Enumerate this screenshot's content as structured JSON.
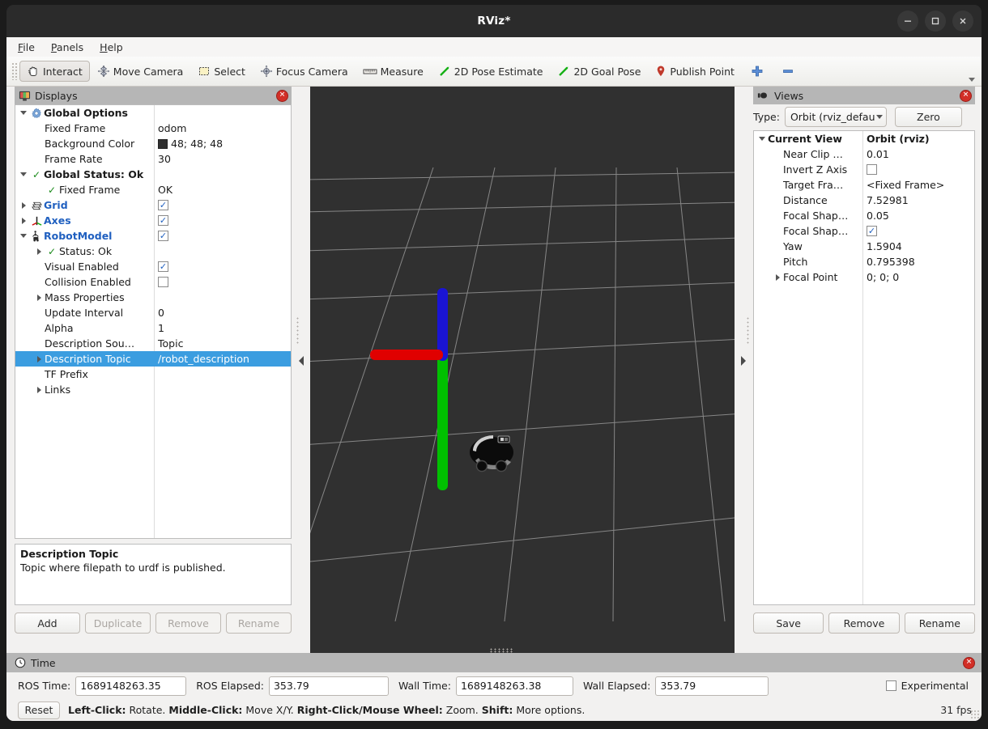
{
  "window": {
    "title": "RViz*",
    "controls": [
      {
        "name": "minimize",
        "glyph": "minimize-icon"
      },
      {
        "name": "maximize",
        "glyph": "maximize-icon"
      },
      {
        "name": "close",
        "glyph": "close-icon"
      }
    ]
  },
  "menu": {
    "items": [
      {
        "label": "File",
        "mnemonic": "F"
      },
      {
        "label": "Panels",
        "mnemonic": "P"
      },
      {
        "label": "Help",
        "mnemonic": "H"
      }
    ]
  },
  "toolbar": {
    "buttons": [
      {
        "label": "Interact",
        "icon": "hand-cursor-icon",
        "checked": true
      },
      {
        "label": "Move Camera",
        "icon": "move-camera-icon",
        "checked": false
      },
      {
        "label": "Select",
        "icon": "selection-rect-icon",
        "checked": false
      },
      {
        "label": "Focus Camera",
        "icon": "focus-camera-icon",
        "checked": false
      },
      {
        "label": "Measure",
        "icon": "ruler-icon",
        "checked": false
      },
      {
        "label": "2D Pose Estimate",
        "icon": "green-arrow-icon",
        "checked": false
      },
      {
        "label": "2D Goal Pose",
        "icon": "green-arrow-icon",
        "checked": false
      },
      {
        "label": "Publish Point",
        "icon": "map-pin-icon",
        "checked": false
      },
      {
        "label": "",
        "icon": "plus-icon",
        "checked": false
      },
      {
        "label": "",
        "icon": "minus-icon",
        "checked": false
      }
    ]
  },
  "displays": {
    "title": "Displays",
    "rows": [
      {
        "indent": 0,
        "twisty": "open",
        "icon": "gear-icon",
        "label": "Global Options",
        "style": "bold",
        "value": "",
        "valueType": "text"
      },
      {
        "indent": 1,
        "twisty": "none",
        "icon": "none",
        "label": "Fixed Frame",
        "style": "plain",
        "value": "odom",
        "valueType": "text"
      },
      {
        "indent": 1,
        "twisty": "none",
        "icon": "none",
        "label": "Background Color",
        "style": "plain",
        "value": "48; 48; 48",
        "valueType": "color",
        "color": "#303030"
      },
      {
        "indent": 1,
        "twisty": "none",
        "icon": "none",
        "label": "Frame Rate",
        "style": "plain",
        "value": "30",
        "valueType": "text"
      },
      {
        "indent": 0,
        "twisty": "open",
        "icon": "check-icon",
        "label": "Global Status: Ok",
        "style": "bold",
        "value": "",
        "valueType": "text"
      },
      {
        "indent": 1,
        "twisty": "none",
        "icon": "check-icon",
        "label": "Fixed Frame",
        "style": "plain",
        "value": "OK",
        "valueType": "text"
      },
      {
        "indent": 0,
        "twisty": "closed",
        "icon": "grid-icon",
        "label": "Grid",
        "style": "blue",
        "value": "",
        "valueType": "checkbox",
        "checked": true
      },
      {
        "indent": 0,
        "twisty": "closed",
        "icon": "axes-icon",
        "label": "Axes",
        "style": "blue",
        "value": "",
        "valueType": "checkbox",
        "checked": true
      },
      {
        "indent": 0,
        "twisty": "open",
        "icon": "robot-icon",
        "label": "RobotModel",
        "style": "blue",
        "value": "",
        "valueType": "checkbox",
        "checked": true
      },
      {
        "indent": 1,
        "twisty": "closed",
        "icon": "check-icon",
        "label": "Status: Ok",
        "style": "plain",
        "value": "",
        "valueType": "text"
      },
      {
        "indent": 1,
        "twisty": "none",
        "icon": "none",
        "label": "Visual Enabled",
        "style": "plain",
        "value": "",
        "valueType": "checkbox",
        "checked": true
      },
      {
        "indent": 1,
        "twisty": "none",
        "icon": "none",
        "label": "Collision Enabled",
        "style": "plain",
        "value": "",
        "valueType": "checkbox",
        "checked": false
      },
      {
        "indent": 1,
        "twisty": "closed",
        "icon": "none",
        "label": "Mass Properties",
        "style": "plain",
        "value": "",
        "valueType": "text"
      },
      {
        "indent": 1,
        "twisty": "none",
        "icon": "none",
        "label": "Update Interval",
        "style": "plain",
        "value": "0",
        "valueType": "text"
      },
      {
        "indent": 1,
        "twisty": "none",
        "icon": "none",
        "label": "Alpha",
        "style": "plain",
        "value": "1",
        "valueType": "text"
      },
      {
        "indent": 1,
        "twisty": "none",
        "icon": "none",
        "label": "Description Sou…",
        "style": "plain",
        "value": "Topic",
        "valueType": "text"
      },
      {
        "indent": 1,
        "twisty": "closed",
        "icon": "none",
        "label": "Description Topic",
        "style": "plain",
        "value": "/robot_description",
        "valueType": "text",
        "selected": true
      },
      {
        "indent": 1,
        "twisty": "none",
        "icon": "none",
        "label": "TF Prefix",
        "style": "plain",
        "value": "",
        "valueType": "text"
      },
      {
        "indent": 1,
        "twisty": "closed",
        "icon": "none",
        "label": "Links",
        "style": "plain",
        "value": "",
        "valueType": "text"
      }
    ],
    "description": {
      "title": "Description Topic",
      "text": "Topic where filepath to urdf is published."
    },
    "buttons": [
      {
        "label": "Add",
        "enabled": true
      },
      {
        "label": "Duplicate",
        "enabled": false
      },
      {
        "label": "Remove",
        "enabled": false
      },
      {
        "label": "Rename",
        "enabled": false
      }
    ]
  },
  "views": {
    "title": "Views",
    "type_label": "Type:",
    "type_value": "Orbit (rviz_defau",
    "zero_label": "Zero",
    "rows": [
      {
        "indent": 0,
        "twisty": "open",
        "label": "Current View",
        "style": "bold",
        "value": "Orbit (rviz)",
        "valueType": "text",
        "valueStyle": "bold"
      },
      {
        "indent": 1,
        "twisty": "none",
        "label": "Near Clip …",
        "style": "plain",
        "value": "0.01",
        "valueType": "text"
      },
      {
        "indent": 1,
        "twisty": "none",
        "label": "Invert Z Axis",
        "style": "plain",
        "value": "",
        "valueType": "checkbox",
        "checked": false
      },
      {
        "indent": 1,
        "twisty": "none",
        "label": "Target Fra…",
        "style": "plain",
        "value": "<Fixed Frame>",
        "valueType": "text"
      },
      {
        "indent": 1,
        "twisty": "none",
        "label": "Distance",
        "style": "plain",
        "value": "7.52981",
        "valueType": "text"
      },
      {
        "indent": 1,
        "twisty": "none",
        "label": "Focal Shap…",
        "style": "plain",
        "value": "0.05",
        "valueType": "text"
      },
      {
        "indent": 1,
        "twisty": "none",
        "label": "Focal Shap…",
        "style": "plain",
        "value": "",
        "valueType": "checkbox",
        "checked": true
      },
      {
        "indent": 1,
        "twisty": "none",
        "label": "Yaw",
        "style": "plain",
        "value": "1.5904",
        "valueType": "text"
      },
      {
        "indent": 1,
        "twisty": "none",
        "label": "Pitch",
        "style": "plain",
        "value": "0.795398",
        "valueType": "text"
      },
      {
        "indent": 1,
        "twisty": "closed",
        "label": "Focal Point",
        "style": "plain",
        "value": "0; 0; 0",
        "valueType": "text"
      }
    ],
    "buttons": [
      {
        "label": "Save",
        "enabled": true
      },
      {
        "label": "Remove",
        "enabled": true
      },
      {
        "label": "Rename",
        "enabled": true
      }
    ]
  },
  "time": {
    "title": "Time",
    "fields": [
      {
        "label": "ROS Time:",
        "value": "1689148263.35",
        "width": "w1"
      },
      {
        "label": "ROS Elapsed:",
        "value": "353.79",
        "width": "w2"
      },
      {
        "label": "Wall Time:",
        "value": "1689148263.38",
        "width": "w3"
      },
      {
        "label": "Wall Elapsed:",
        "value": "353.79",
        "width": "w4"
      }
    ],
    "experimental_label": "Experimental",
    "experimental_checked": false,
    "reset_label": "Reset",
    "hints": [
      {
        "bold": "Left-Click:",
        "text": " Rotate."
      },
      {
        "bold": "Middle-Click:",
        "text": " Move X/Y."
      },
      {
        "bold": "Right-Click/Mouse Wheel:",
        "text": " Zoom."
      },
      {
        "bold": "Shift:",
        "text": " More options."
      }
    ],
    "fps": "31 fps"
  },
  "render": {
    "background_color": "#303030",
    "grid_color": "#9a9a9a",
    "axes": [
      {
        "name": "x-axis",
        "color": "#e00000"
      },
      {
        "name": "y-axis",
        "color": "#00c000"
      },
      {
        "name": "z-axis",
        "color": "#1a14d4"
      }
    ],
    "robot_name": "turtlebot-robot-model"
  }
}
